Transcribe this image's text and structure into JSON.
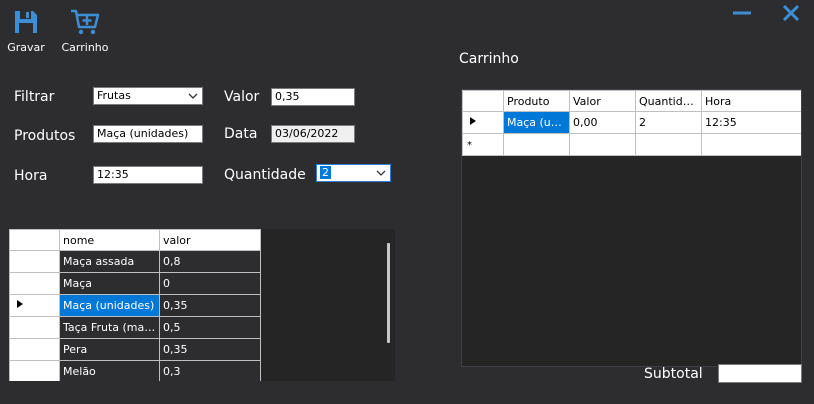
{
  "toolbar": {
    "save_label": "Gravar",
    "cart_label": "Carrinho"
  },
  "window": {
    "minimize_icon": "minus-icon",
    "close_icon": "x-icon"
  },
  "form": {
    "filtrar_label": "Filtrar",
    "filtrar_value": "Frutas",
    "valor_label": "Valor",
    "valor_value": "0,35",
    "produtos_label": "Produtos",
    "produtos_value": "Maça (unidades)",
    "data_label": "Data",
    "data_value": "03/06/2022",
    "hora_label": "Hora",
    "hora_value": "12:35",
    "quantidade_label": "Quantidade",
    "quantidade_value": "2"
  },
  "products_grid": {
    "columns": [
      "nome",
      "valor"
    ],
    "rows": [
      {
        "nome": "Maça assada",
        "valor": "0,8"
      },
      {
        "nome": "Maça",
        "valor": "0"
      },
      {
        "nome": "Maça (unidades)",
        "valor": "0,35"
      },
      {
        "nome": "Taça Fruta (maç...",
        "valor": "0,5"
      },
      {
        "nome": "Pera",
        "valor": "0,35"
      },
      {
        "nome": "Melão",
        "valor": "0,3"
      }
    ]
  },
  "cart": {
    "title": "Carrinho",
    "columns": [
      "Produto",
      "Valor",
      "Quantidade",
      "Hora"
    ],
    "rows": [
      {
        "produto": "Maça (uni...",
        "valor": "0,00",
        "quantidade": "2",
        "hora": "12:35"
      }
    ],
    "new_row_marker": "*"
  },
  "subtotal": {
    "label": "Subtotal",
    "value": ""
  },
  "colors": {
    "background": "#2d2d30",
    "accent": "#3c8fd6",
    "selection": "#0078d7"
  }
}
